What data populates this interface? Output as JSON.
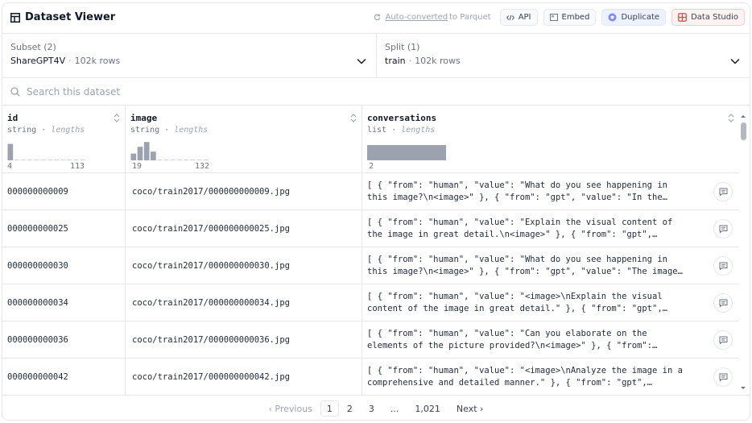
{
  "header": {
    "title": "Dataset Viewer",
    "auto_converted_link": "Auto-converted",
    "auto_converted_rest": "to Parquet",
    "api_label": "API",
    "embed_label": "Embed",
    "duplicate_label": "Duplicate",
    "data_studio_label": "Data Studio"
  },
  "subset": {
    "label": "Subset (2)",
    "value": "ShareGPT4V",
    "rows": "102k rows"
  },
  "split": {
    "label": "Split (1)",
    "value": "train",
    "rows": "102k rows"
  },
  "search": {
    "placeholder": "Search this dataset"
  },
  "columns": [
    {
      "name": "id",
      "type": "string",
      "stat": "lengths",
      "min": "4",
      "max": "113",
      "hist": [
        0.85,
        0,
        0,
        0,
        0,
        0,
        0,
        0,
        0,
        0,
        0,
        0
      ]
    },
    {
      "name": "image",
      "type": "string",
      "stat": "lengths",
      "min": "19",
      "max": "132",
      "hist": [
        0.35,
        0.7,
        0.95,
        0.45,
        0,
        0,
        0,
        0,
        0,
        0,
        0,
        0
      ]
    },
    {
      "name": "conversations",
      "type": "list",
      "stat": "lengths",
      "min": "2",
      "max": "",
      "hist": [
        1.0
      ]
    }
  ],
  "rows": [
    {
      "id": "000000000009",
      "image": "coco/train2017/000000000009.jpg",
      "conv1": "[ { \"from\": \"human\", \"value\": \"What do you see happening in",
      "conv2": "this image?\\n<image>\" }, { \"from\": \"gpt\", \"value\": \"In the…"
    },
    {
      "id": "000000000025",
      "image": "coco/train2017/000000000025.jpg",
      "conv1": "[ { \"from\": \"human\", \"value\": \"Explain the visual content of",
      "conv2": "the image in great detail.\\n<image>\" }, { \"from\": \"gpt\",…"
    },
    {
      "id": "000000000030",
      "image": "coco/train2017/000000000030.jpg",
      "conv1": "[ { \"from\": \"human\", \"value\": \"What do you see happening in",
      "conv2": "this image?\\n<image>\" }, { \"from\": \"gpt\", \"value\": \"The image…"
    },
    {
      "id": "000000000034",
      "image": "coco/train2017/000000000034.jpg",
      "conv1": "[ { \"from\": \"human\", \"value\": \"<image>\\nExplain the visual",
      "conv2": "content of the image in great detail.\" }, { \"from\": \"gpt\",…"
    },
    {
      "id": "000000000036",
      "image": "coco/train2017/000000000036.jpg",
      "conv1": "[ { \"from\": \"human\", \"value\": \"Can you elaborate on the",
      "conv2": "elements of the picture provided?\\n<image>\" }, { \"from\":…"
    },
    {
      "id": "000000000042",
      "image": "coco/train2017/000000000042.jpg",
      "conv1": "[ { \"from\": \"human\", \"value\": \"<image>\\nAnalyze the image in a",
      "conv2": "comprehensive and detailed manner.\" }, { \"from\": \"gpt\",…"
    }
  ],
  "pagination": {
    "previous": "‹ Previous",
    "pages": [
      "1",
      "2",
      "3",
      "...",
      "1,021"
    ],
    "current": "1",
    "next": "Next ›"
  },
  "colors": {
    "hist_bar": "#9ca3af",
    "hist_empty": "#d1d5db",
    "border": "#e5e7eb",
    "duplicate_bg": "#eef2ff",
    "data_studio_bg": "#fef2f2"
  }
}
